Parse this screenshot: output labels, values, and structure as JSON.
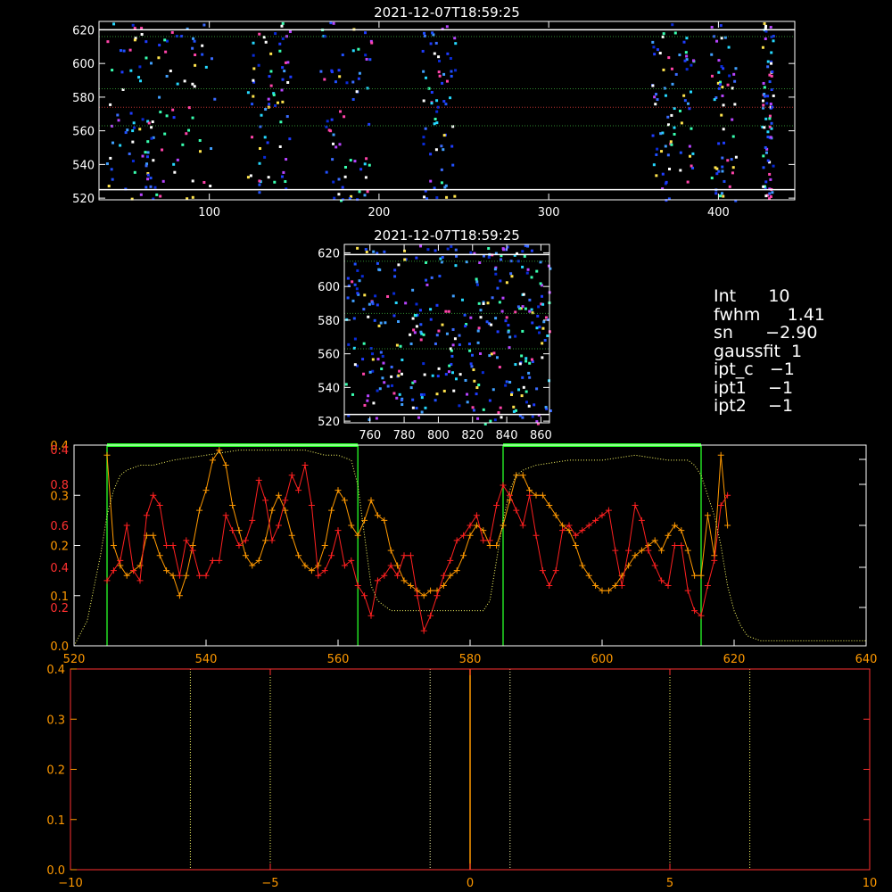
{
  "chart_data": [
    {
      "id": "top_raster",
      "type": "heatmap",
      "title": "2021-12-07T18:59:25",
      "xlim": [
        35,
        445
      ],
      "ylim": [
        519,
        625
      ],
      "xticks": [
        100,
        200,
        300,
        400
      ],
      "yticks": [
        520,
        540,
        560,
        580,
        600,
        620
      ],
      "hlines": [
        {
          "y": 616,
          "style": "dotted",
          "color": "#2e8b2e"
        },
        {
          "y": 585,
          "style": "dotted",
          "color": "#2e8b2e"
        },
        {
          "y": 574,
          "style": "dotted",
          "color": "#b8312f"
        },
        {
          "y": 563,
          "style": "dotted",
          "color": "#2e8b2e"
        },
        {
          "y": 620,
          "style": "solid",
          "color": "#ffffff"
        },
        {
          "y": 525,
          "style": "solid",
          "color": "#ffffff"
        }
      ],
      "clusters_x": [
        [
          38,
          70
        ],
        [
          58,
          105
        ],
        [
          122,
          148
        ],
        [
          165,
          195
        ],
        [
          225,
          245
        ],
        [
          360,
          385
        ],
        [
          395,
          410
        ],
        [
          425,
          432
        ]
      ]
    },
    {
      "id": "middle_raster",
      "type": "heatmap",
      "title": "2021-12-07T18:59:25",
      "xlim": [
        745,
        865
      ],
      "ylim": [
        519,
        625
      ],
      "xticks": [
        760,
        780,
        800,
        820,
        840,
        860
      ],
      "yticks": [
        520,
        540,
        560,
        580,
        600,
        620
      ],
      "hlines": [
        {
          "y": 615,
          "style": "dotted",
          "color": "#2e8b2e"
        },
        {
          "y": 584,
          "style": "dotted",
          "color": "#2e8b2e"
        },
        {
          "y": 563,
          "style": "dotted",
          "color": "#2e8b2e"
        },
        {
          "y": 619,
          "style": "solid",
          "color": "#ffffff"
        },
        {
          "y": 524,
          "style": "solid",
          "color": "#ffffff"
        }
      ]
    },
    {
      "id": "profile",
      "type": "line",
      "xlim": [
        520,
        640
      ],
      "xticks": [
        520,
        540,
        560,
        580,
        600,
        620,
        640
      ],
      "ylim": [
        0,
        0.4
      ],
      "left_ticks_orange": [
        "0.0",
        "0.1",
        "0.2",
        "0.3",
        "0.4"
      ],
      "left_ticks_red": [
        "0.2",
        "0.4",
        "0.6",
        "0.8"
      ],
      "regions": [
        [
          525,
          563
        ],
        [
          585,
          615
        ]
      ],
      "series": [
        {
          "color": "#ff9900",
          "x": [
            525,
            526,
            527,
            528,
            529,
            530,
            531,
            532,
            533,
            534,
            535,
            536,
            537,
            538,
            539,
            540,
            541,
            542,
            543,
            544,
            545,
            546,
            547,
            548,
            549,
            550,
            551,
            552,
            553,
            554,
            555,
            556,
            557,
            558,
            559,
            560,
            561,
            562,
            563,
            564,
            565,
            566,
            567,
            568,
            569,
            570,
            571,
            572,
            573,
            574,
            575,
            576,
            577,
            578,
            579,
            580,
            581,
            582,
            583,
            584,
            585,
            586,
            587,
            588,
            589,
            590,
            591,
            592,
            593,
            594,
            595,
            596,
            597,
            598,
            599,
            600,
            601,
            602,
            603,
            604,
            605,
            606,
            607,
            608,
            609,
            610,
            611,
            612,
            613,
            614,
            615,
            616,
            617,
            618,
            619
          ],
          "y": [
            0.38,
            0.2,
            0.16,
            0.14,
            0.15,
            0.16,
            0.22,
            0.22,
            0.18,
            0.15,
            0.14,
            0.1,
            0.14,
            0.2,
            0.27,
            0.31,
            0.37,
            0.39,
            0.36,
            0.28,
            0.23,
            0.18,
            0.16,
            0.17,
            0.21,
            0.27,
            0.3,
            0.27,
            0.22,
            0.18,
            0.16,
            0.15,
            0.16,
            0.2,
            0.27,
            0.31,
            0.29,
            0.24,
            0.22,
            0.25,
            0.29,
            0.26,
            0.25,
            0.19,
            0.16,
            0.13,
            0.12,
            0.11,
            0.1,
            0.11,
            0.11,
            0.12,
            0.14,
            0.15,
            0.18,
            0.22,
            0.24,
            0.23,
            0.2,
            0.2,
            0.24,
            0.29,
            0.34,
            0.34,
            0.31,
            0.3,
            0.3,
            0.28,
            0.26,
            0.24,
            0.23,
            0.2,
            0.16,
            0.14,
            0.12,
            0.11,
            0.11,
            0.12,
            0.14,
            0.16,
            0.18,
            0.19,
            0.2,
            0.21,
            0.19,
            0.22,
            0.24,
            0.23,
            0.19,
            0.14,
            0.14,
            0.26,
            0.18,
            0.38,
            0.24
          ]
        },
        {
          "color": "#ff2020",
          "x": [
            525,
            526,
            527,
            528,
            529,
            530,
            531,
            532,
            533,
            534,
            535,
            536,
            537,
            538,
            539,
            540,
            541,
            542,
            543,
            544,
            545,
            546,
            547,
            548,
            549,
            550,
            551,
            552,
            553,
            554,
            555,
            556,
            557,
            558,
            559,
            560,
            561,
            562,
            563,
            564,
            565,
            566,
            567,
            568,
            569,
            570,
            571,
            572,
            573,
            574,
            575,
            576,
            577,
            578,
            579,
            580,
            581,
            582,
            583,
            584,
            585,
            586,
            587,
            588,
            589,
            590,
            591,
            592,
            593,
            594,
            595,
            596,
            597,
            598,
            599,
            600,
            601,
            602,
            603,
            604,
            605,
            606,
            607,
            608,
            609,
            610,
            611,
            612,
            613,
            614,
            615,
            616,
            617,
            618,
            619
          ],
          "y": [
            0.13,
            0.15,
            0.17,
            0.24,
            0.15,
            0.13,
            0.26,
            0.3,
            0.28,
            0.2,
            0.2,
            0.14,
            0.21,
            0.19,
            0.14,
            0.14,
            0.17,
            0.17,
            0.26,
            0.23,
            0.2,
            0.21,
            0.25,
            0.33,
            0.29,
            0.21,
            0.24,
            0.29,
            0.34,
            0.31,
            0.36,
            0.28,
            0.14,
            0.15,
            0.18,
            0.23,
            0.16,
            0.17,
            0.12,
            0.1,
            0.06,
            0.13,
            0.14,
            0.16,
            0.14,
            0.18,
            0.18,
            0.1,
            0.03,
            0.06,
            0.1,
            0.14,
            0.17,
            0.21,
            0.22,
            0.24,
            0.26,
            0.21,
            0.21,
            0.28,
            0.32,
            0.3,
            0.27,
            0.24,
            0.3,
            0.22,
            0.15,
            0.12,
            0.15,
            0.23,
            0.24,
            0.22,
            0.23,
            0.24,
            0.25,
            0.26,
            0.27,
            0.19,
            0.12,
            0.19,
            0.28,
            0.25,
            0.19,
            0.16,
            0.13,
            0.12,
            0.2,
            0.2,
            0.11,
            0.07,
            0.06,
            0.12,
            0.17,
            0.28,
            0.3
          ]
        },
        {
          "color": "#ffff66",
          "style": "dotted",
          "x": [
            520,
            522,
            524,
            525,
            526,
            527,
            528,
            530,
            532,
            535,
            540,
            545,
            550,
            555,
            558,
            560,
            562,
            563,
            564,
            565,
            566,
            567,
            568,
            570,
            572,
            575,
            580,
            582,
            583,
            584,
            585,
            586,
            587,
            588,
            590,
            595,
            600,
            605,
            610,
            613,
            614,
            615,
            616,
            617,
            618,
            619,
            620,
            621,
            622,
            624,
            630,
            640
          ],
          "y": [
            0.0,
            0.05,
            0.18,
            0.26,
            0.31,
            0.34,
            0.35,
            0.36,
            0.36,
            0.37,
            0.38,
            0.39,
            0.39,
            0.39,
            0.38,
            0.38,
            0.37,
            0.32,
            0.22,
            0.12,
            0.09,
            0.08,
            0.07,
            0.07,
            0.07,
            0.07,
            0.07,
            0.07,
            0.09,
            0.17,
            0.25,
            0.31,
            0.34,
            0.35,
            0.36,
            0.37,
            0.37,
            0.38,
            0.37,
            0.37,
            0.36,
            0.34,
            0.3,
            0.26,
            0.2,
            0.12,
            0.07,
            0.04,
            0.02,
            0.01,
            0.01,
            0.01
          ]
        }
      ]
    },
    {
      "id": "bottom",
      "type": "line",
      "xlim": [
        -10,
        10
      ],
      "ylim": [
        0,
        0.4
      ],
      "xticks": [
        "-10",
        "-5",
        "0",
        "5",
        "10"
      ],
      "yticks": [
        "0.0",
        "0.1",
        "0.2",
        "0.3",
        "0.4"
      ],
      "vlines": [
        {
          "x": -7,
          "color": "#ffff66"
        },
        {
          "x": -5,
          "color": "#ffff66"
        },
        {
          "x": -1,
          "color": "#ffffaa"
        },
        {
          "x": 1,
          "color": "#ffffaa"
        },
        {
          "x": 5,
          "color": "#ffff66"
        },
        {
          "x": 7,
          "color": "#ffff66"
        }
      ],
      "spike": {
        "x": 0,
        "y": 0.4,
        "color": "#ff9900"
      }
    }
  ],
  "info": {
    "rows": [
      "Int      10",
      "fwhm     1.41",
      "sn      −2.90",
      "gaussfit  1",
      "ipt_c   −1",
      "ipt1    −1",
      "ipt2    −1"
    ]
  }
}
